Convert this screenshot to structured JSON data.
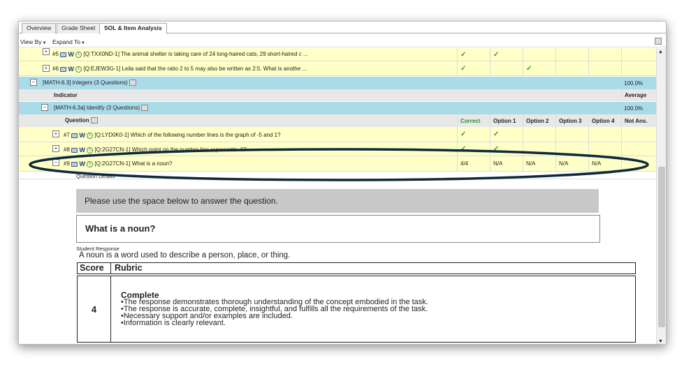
{
  "tabs": [
    {
      "label": "Overview",
      "active": false
    },
    {
      "label": "Grade Sheet",
      "active": false
    },
    {
      "label": "SOL & Item Analysis",
      "active": true
    }
  ],
  "toolbar": {
    "view_by": "View By",
    "expand_to": "Expand To"
  },
  "items": {
    "q5": {
      "num": "#5",
      "text": "[Q:TXX0ND-1] The animal shelter is taking care of 24 long-haired cats, 29 short-haired c ..."
    },
    "q6": {
      "num": "#6",
      "text": "[Q:EJEW3G-1] Leila said that the ratio 2 to 5 may also be written as 2:5. What is anothe ..."
    },
    "q7": {
      "num": "#7",
      "text": "[Q:LYD0K0-1] Which of the following number lines is the graph of -5 and 1?"
    },
    "q8": {
      "num": "#8",
      "text": "[Q:2G27CN-1] Which point on the number line represents -6?"
    },
    "q9": {
      "num": "#9",
      "text": "[Q:2G27CN-1] What is a noun?",
      "correct": "4/4",
      "opt1": "N/A",
      "opt2": "N/A",
      "opt3": "N/A",
      "opt4": "N/A"
    }
  },
  "math63": {
    "label": "[MATH-6.3] Integers (3 Questions)",
    "pct": "100.0%"
  },
  "indicator_header": {
    "indicator": "Indicator",
    "average": "Average"
  },
  "math63a": {
    "label": "[MATH-6.3a] Identify (3 Questions)",
    "pct": "100.0%"
  },
  "question_header": {
    "question": "Question",
    "correct": "Correct",
    "opt1": "Option 1",
    "opt2": "Option 2",
    "opt3": "Option 3",
    "opt4": "Option 4",
    "notans": "Not Ans."
  },
  "detail": {
    "section_label": "Question Details",
    "instruction": "Please use the space below to answer the question.",
    "question": "What is a noun?",
    "student_response_label": "Student Response",
    "student_response": "A noun is a word used to describe a person, place, or thing.",
    "score_header": "Score",
    "rubric_header": "Rubric",
    "score": "4",
    "rubric_title": "Complete",
    "rubric_lines": [
      "•The response demonstrates thorough understanding of the concept embodied in the task.",
      "•The response is accurate, complete, insightful, and fulfills all the requirements of the task.",
      "•Necessary support and/or examples are included.",
      "•Information is clearly relevant."
    ]
  },
  "colors": {
    "row_yellow": "#ffffc8",
    "row_blue": "#aadbe8",
    "check_green": "#2a9d2a",
    "oval": "#0e2a3a"
  },
  "icons": {
    "expand": "plus-box-icon",
    "collapse": "minus-box-icon",
    "computer": "computer-icon",
    "print": "printer-icon",
    "check": "checkmark-icon"
  }
}
